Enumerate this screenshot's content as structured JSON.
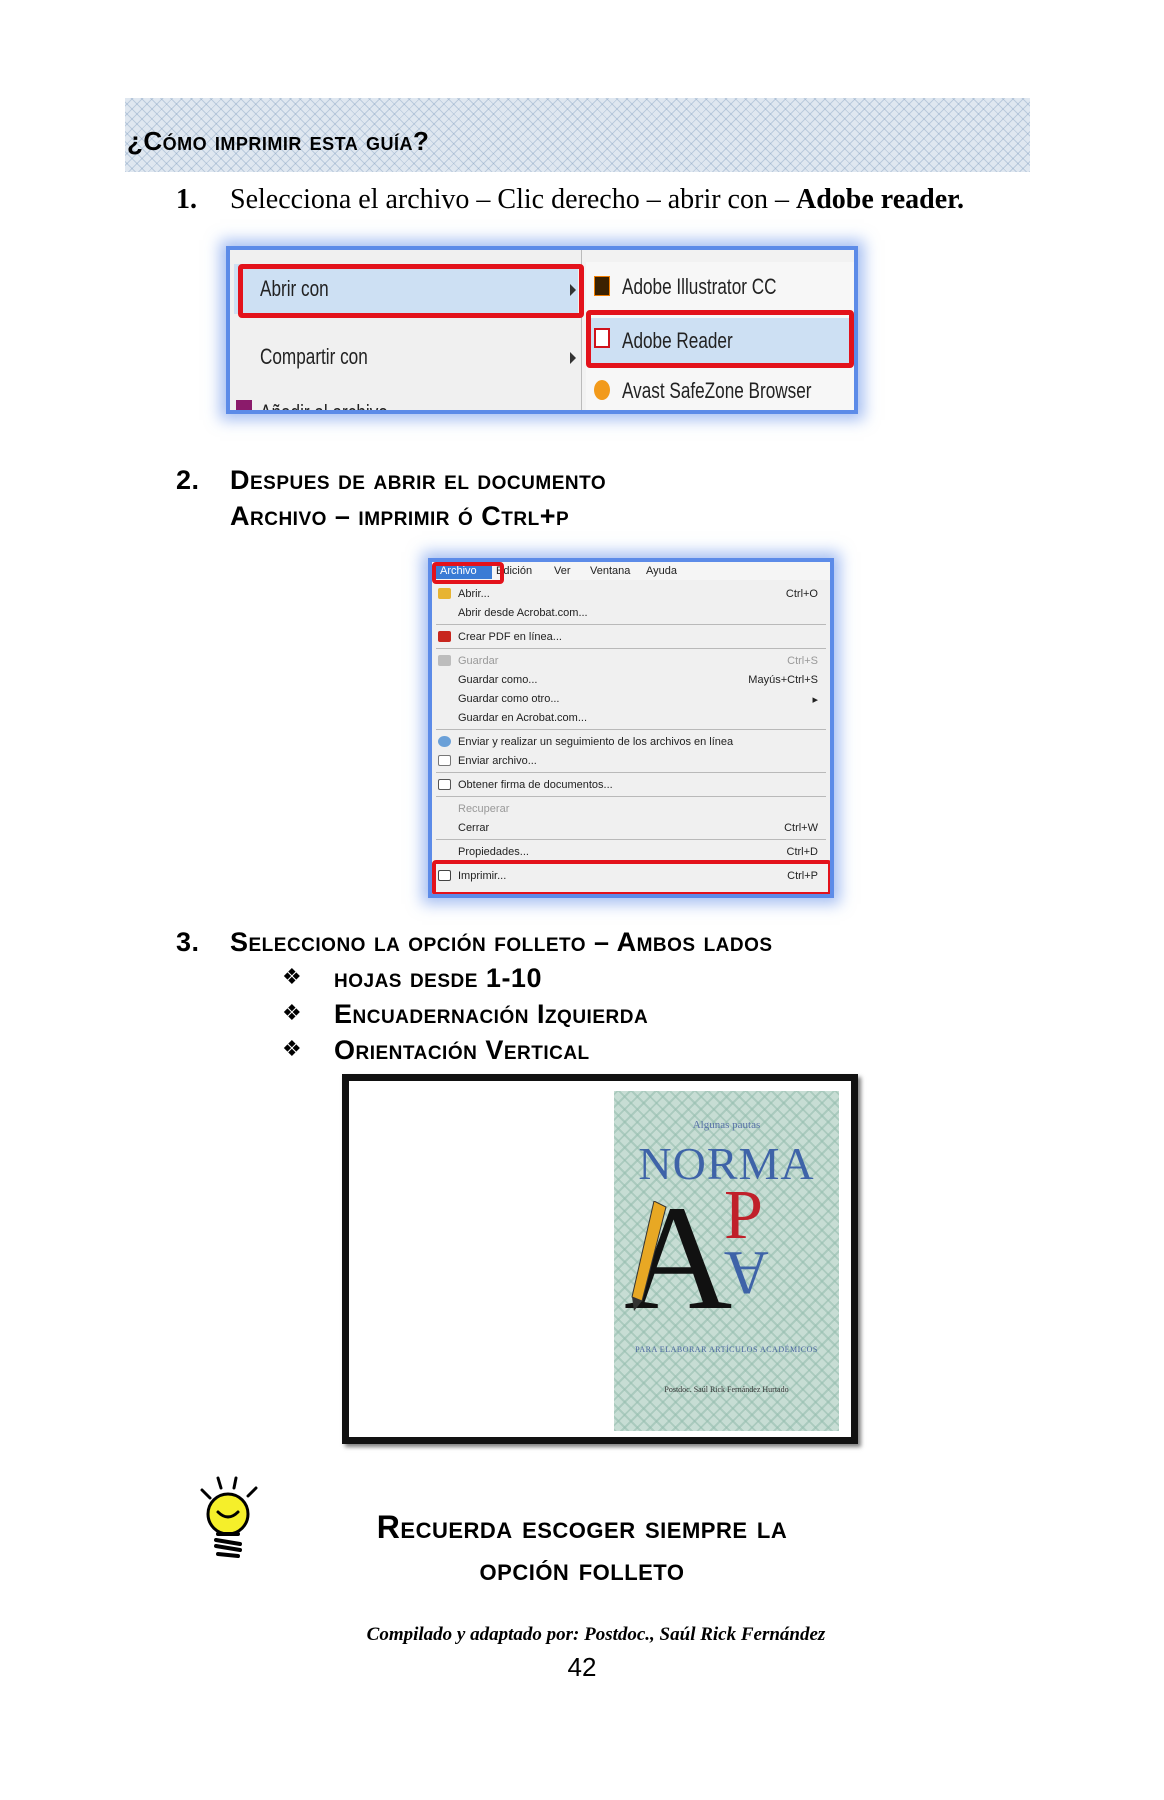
{
  "header": {
    "title": "¿Cómo imprimir esta guía?"
  },
  "step1": {
    "number": "1.",
    "text": "Selecciona el archivo – Clic derecho – abrir con – ",
    "bold": "Adobe reader."
  },
  "context_menu": {
    "left_items": [
      "Abrir con",
      "Compartir con",
      "Añadir al archivo..."
    ],
    "right_items": [
      "Adobe Illustrator CC",
      "Adobe Reader",
      "Avast SafeZone Browser"
    ]
  },
  "step2": {
    "number": "2.",
    "line1": "Despues de abrir el documento",
    "line2": "Archivo – imprimir   ó  Ctrl+p"
  },
  "file_menu": {
    "menubar": [
      "Archivo",
      "Edición",
      "Ver",
      "Ventana",
      "Ayuda"
    ],
    "items": [
      {
        "label": "Abrir...",
        "shortcut": "Ctrl+O"
      },
      {
        "label": "Abrir desde Acrobat.com...",
        "shortcut": ""
      },
      {
        "label": "Crear PDF en línea...",
        "shortcut": ""
      },
      {
        "label": "Guardar",
        "shortcut": "Ctrl+S"
      },
      {
        "label": "Guardar como...",
        "shortcut": "Mayús+Ctrl+S"
      },
      {
        "label": "Guardar como otro...",
        "shortcut": "▸"
      },
      {
        "label": "Guardar en Acrobat.com...",
        "shortcut": ""
      },
      {
        "label": "Enviar y realizar un seguimiento de los archivos en línea",
        "shortcut": ""
      },
      {
        "label": "Enviar archivo...",
        "shortcut": ""
      },
      {
        "label": "Obtener firma de documentos...",
        "shortcut": ""
      },
      {
        "label": "Recuperar",
        "shortcut": ""
      },
      {
        "label": "Cerrar",
        "shortcut": "Ctrl+W"
      },
      {
        "label": "Propiedades...",
        "shortcut": "Ctrl+D"
      },
      {
        "label": "Imprimir...",
        "shortcut": "Ctrl+P"
      }
    ]
  },
  "step3": {
    "number": "3.",
    "title": "Selecciono la opción folleto – Ambos lados",
    "bullet_symbol": "❖",
    "bullets": [
      "hojas desde 1-10",
      "Encuadernación Izquierda",
      "Orientación Vertical"
    ]
  },
  "book_cover": {
    "pre_title": "Algunas pautas",
    "title": "NORMA",
    "letter_a": "A",
    "letter_p": "P",
    "letter_a2": "A",
    "subtitle": "PARA ELABORAR ARTÍCULOS ACADÉMICOS",
    "author": "Postdoc. Saúl Rick Fernández Hurtado"
  },
  "reminder": {
    "line1": "Recuerda escoger siempre la",
    "line2": "opción folleto"
  },
  "footer": {
    "credit": "Compilado y adaptado por: Postdoc., Saúl Rick Fernández",
    "page_number": "42"
  }
}
